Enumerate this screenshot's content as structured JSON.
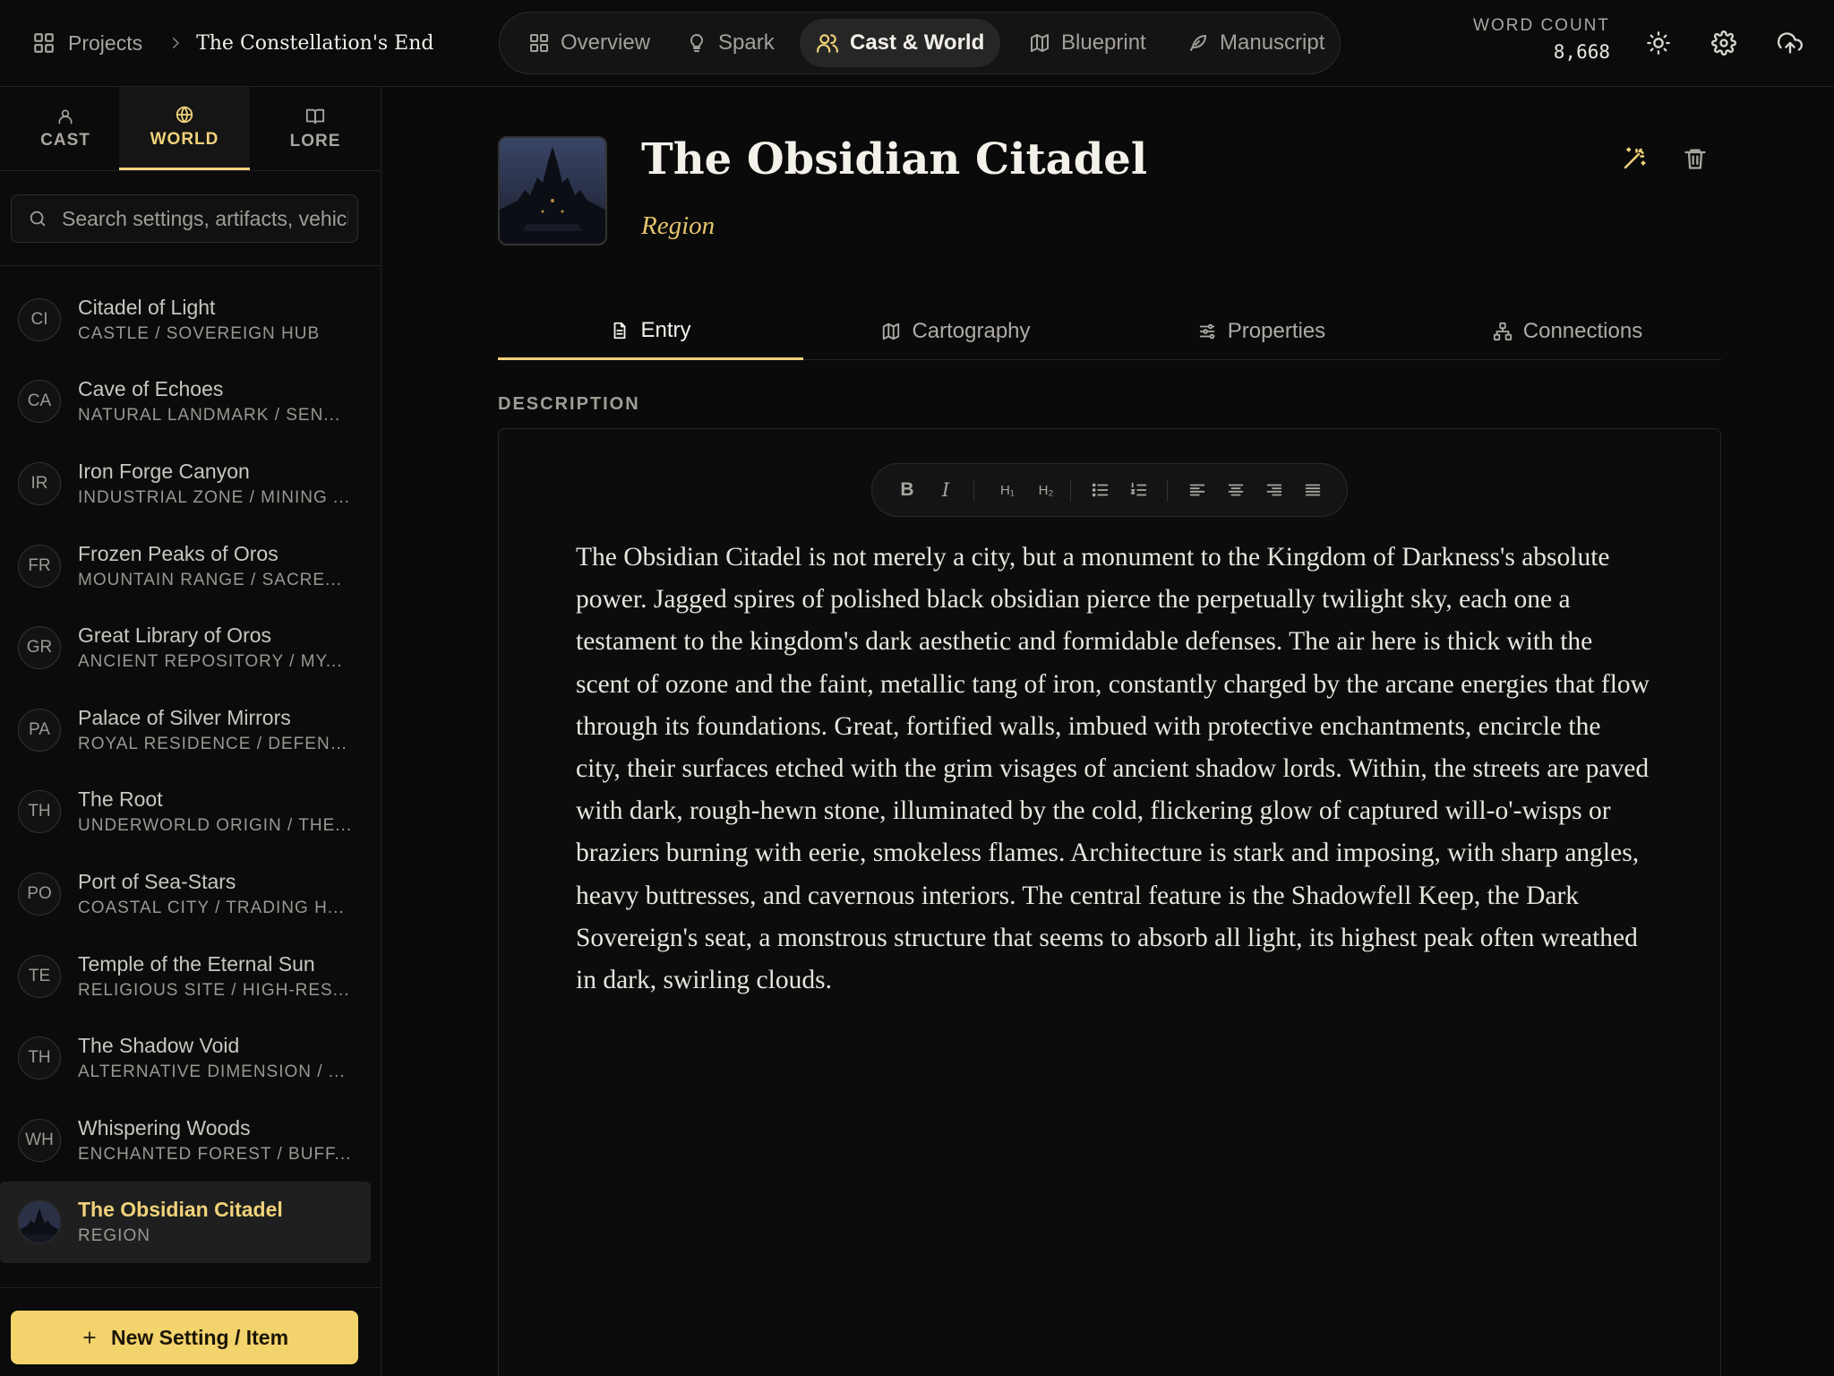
{
  "breadcrumb": {
    "projects_label": "Projects",
    "separator": "›",
    "current": "The Constellation's End"
  },
  "nav": {
    "tabs": [
      {
        "label": "Overview",
        "icon": "grid-icon"
      },
      {
        "label": "Spark",
        "icon": "lightbulb-icon"
      },
      {
        "label": "Cast & World",
        "icon": "users-icon",
        "active": true
      },
      {
        "label": "Blueprint",
        "icon": "map-icon"
      },
      {
        "label": "Manuscript",
        "icon": "feather-icon"
      }
    ]
  },
  "word_count": {
    "label": "WORD COUNT",
    "value": "8,668"
  },
  "top_icons": [
    "sun-icon",
    "gear-icon",
    "cloud-upload-icon"
  ],
  "sidebar": {
    "tabs": [
      {
        "label": "CAST",
        "icon": "person-icon"
      },
      {
        "label": "WORLD",
        "icon": "globe-icon",
        "active": true
      },
      {
        "label": "LORE",
        "icon": "book-icon"
      }
    ],
    "search_placeholder": "Search settings, artifacts, vehicles...",
    "items": [
      {
        "initials": "CI",
        "name": "Citadel of Light",
        "subtitle": "CASTLE / SOVEREIGN HUB"
      },
      {
        "initials": "CA",
        "name": "Cave of Echoes",
        "subtitle": "NATURAL LANDMARK / SEN..."
      },
      {
        "initials": "IR",
        "name": "Iron Forge Canyon",
        "subtitle": "INDUSTRIAL ZONE / MINING ..."
      },
      {
        "initials": "FR",
        "name": "Frozen Peaks of Oros",
        "subtitle": "MOUNTAIN RANGE / SACRE..."
      },
      {
        "initials": "GR",
        "name": "Great Library of Oros",
        "subtitle": "ANCIENT REPOSITORY / MY..."
      },
      {
        "initials": "PA",
        "name": "Palace of Silver Mirrors",
        "subtitle": "ROYAL RESIDENCE / DEFENS..."
      },
      {
        "initials": "TH",
        "name": "The Root",
        "subtitle": "UNDERWORLD ORIGIN / THE..."
      },
      {
        "initials": "PO",
        "name": "Port of Sea-Stars",
        "subtitle": "COASTAL CITY / TRADING H..."
      },
      {
        "initials": "TE",
        "name": "Temple of the Eternal Sun",
        "subtitle": "RELIGIOUS SITE / HIGH-RES..."
      },
      {
        "initials": "TH",
        "name": "The Shadow Void",
        "subtitle": "ALTERNATIVE DIMENSION / ..."
      },
      {
        "initials": "WH",
        "name": "Whispering Woods",
        "subtitle": "ENCHANTED FOREST / BUFF..."
      },
      {
        "initials": "",
        "name": "The Obsidian Citadel",
        "subtitle": "REGION",
        "active": true
      }
    ],
    "new_button": "New Setting / Item"
  },
  "entry": {
    "title": "The Obsidian Citadel",
    "type": "Region",
    "tabs": [
      {
        "label": "Entry",
        "icon": "document-icon",
        "active": true
      },
      {
        "label": "Cartography",
        "icon": "map-icon"
      },
      {
        "label": "Properties",
        "icon": "sliders-icon"
      },
      {
        "label": "Connections",
        "icon": "network-icon"
      }
    ],
    "section_label": "DESCRIPTION",
    "toolbar": {
      "bold": "B",
      "italic": "I",
      "h1": "H₁",
      "h2": "H₂"
    },
    "description": "The Obsidian Citadel is not merely a city, but a monument to the Kingdom of Darkness's absolute power. Jagged spires of polished black obsidian pierce the perpetually twilight sky, each one a testament to the kingdom's dark aesthetic and formidable defenses. The air here is thick with the scent of ozone and the faint, metallic tang of iron, constantly charged by the arcane energies that flow through its foundations. Great, fortified walls, imbued with protective enchantments, encircle the city, their surfaces etched with the grim visages of ancient shadow lords. Within, the streets are paved with dark, rough-hewn stone, illuminated by the cold, flickering glow of captured will-o'-wisps or braziers burning with eerie, smokeless flames. Architecture is stark and imposing, with sharp angles, heavy buttresses, and cavernous interiors. The central feature is the Shadowfell Keep, the Dark Sovereign's seat, a monstrous structure that seems to absorb all light, its highest peak often wreathed in dark, swirling clouds."
  },
  "colors": {
    "accent": "#f0d27a",
    "background": "#0a0a0a",
    "button": "#f3d36b"
  }
}
